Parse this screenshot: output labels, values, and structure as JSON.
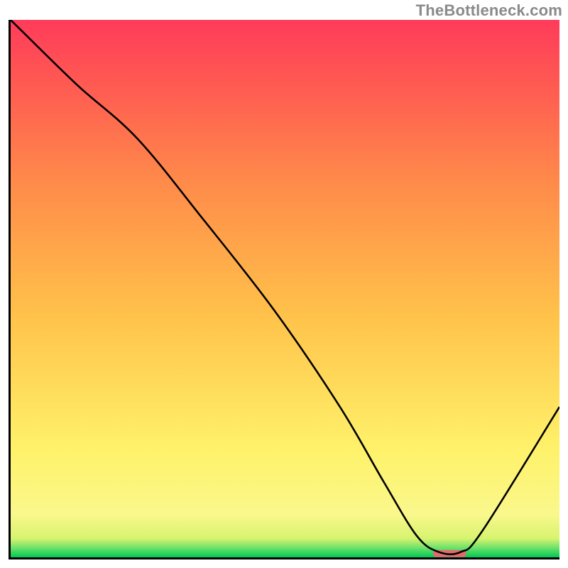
{
  "watermark": "TheBottleneck.com",
  "chart_data": {
    "type": "line",
    "title": "",
    "xlabel": "",
    "ylabel": "",
    "xlim": [
      0,
      100
    ],
    "ylim": [
      0,
      100
    ],
    "grid": false,
    "series": [
      {
        "name": "curve",
        "x": [
          0,
          12,
          23,
          35,
          48,
          60,
          68,
          74,
          78,
          82,
          86,
          100
        ],
        "values": [
          100,
          88,
          78,
          63,
          46,
          28,
          14,
          4,
          1,
          1,
          5,
          28
        ]
      }
    ],
    "marker": {
      "name": "highlight-segment",
      "x_center": 80,
      "y": 0.7,
      "width": 6,
      "color": "#e26a6f"
    },
    "gradient_stops": [
      {
        "offset": 0.0,
        "color": "#00c853"
      },
      {
        "offset": 0.018,
        "color": "#6fe26a"
      },
      {
        "offset": 0.035,
        "color": "#d7f36f"
      },
      {
        "offset": 0.08,
        "color": "#faf88c"
      },
      {
        "offset": 0.2,
        "color": "#fff26a"
      },
      {
        "offset": 0.45,
        "color": "#ffc24a"
      },
      {
        "offset": 0.7,
        "color": "#ff8a4a"
      },
      {
        "offset": 0.88,
        "color": "#ff5a52"
      },
      {
        "offset": 1.0,
        "color": "#ff3b5a"
      }
    ]
  }
}
